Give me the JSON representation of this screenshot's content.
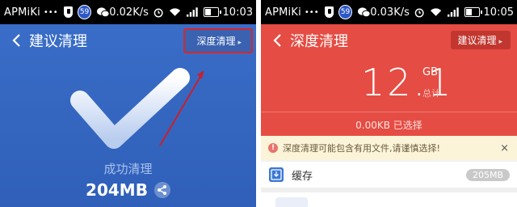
{
  "left_screen": {
    "status": {
      "carrier": "APMiKi",
      "dots": "•••",
      "badge": "59",
      "speed": "0.02K/s",
      "time": "10:03",
      "battery_level": 0.45
    },
    "header": {
      "back_icon": "back-chevron-icon",
      "title": "建议清理",
      "deep_clean_button": "深度清理"
    },
    "result": {
      "message": "成功清理",
      "size": "204MB",
      "share_icon": "share-icon"
    },
    "colors": {
      "background": "#3264bd",
      "highlight": "#d9262c"
    }
  },
  "right_screen": {
    "status": {
      "carrier": "APMiKi",
      "dots": "•••",
      "badge": "59",
      "speed": "0.03K/s",
      "time": "10:05",
      "battery_level": 0.45
    },
    "header": {
      "back_icon": "back-chevron-icon",
      "title": "深度清理",
      "suggest_clean_button": "建议清理"
    },
    "summary": {
      "total_size": "12.1",
      "unit": "GB",
      "total_label": "总计",
      "selected_text": "0.00KB 已选择"
    },
    "warning": {
      "icon": "info-icon",
      "text": "深度清理可能包含有用文件,请谨慎选择!",
      "close": "×"
    },
    "categories": [
      {
        "icon": "download-box-icon",
        "label": "缓存",
        "size": "205MB"
      }
    ],
    "colors": {
      "panel": "#e54c43",
      "warning_bg": "#fbf4d9"
    }
  }
}
